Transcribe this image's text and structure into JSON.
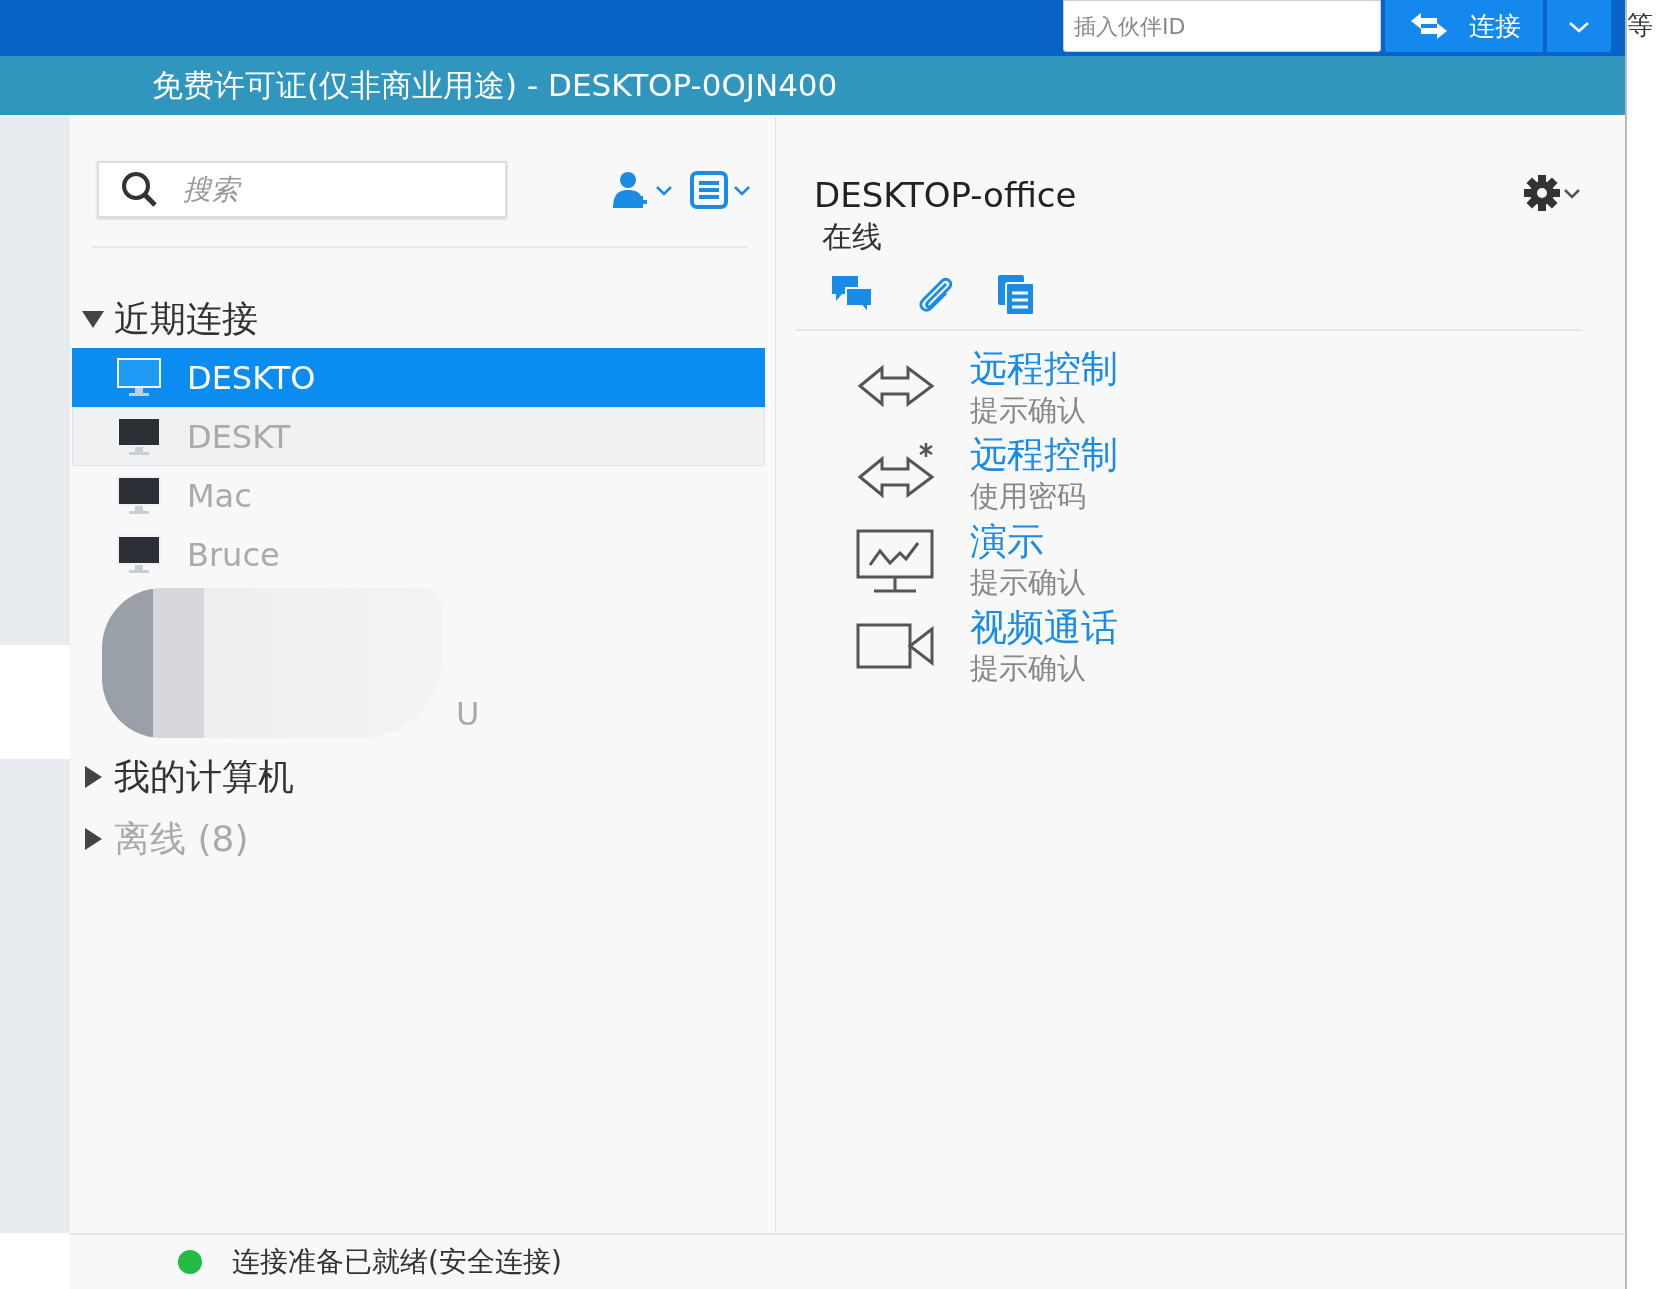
{
  "top_bar": {
    "partner_id_field": {
      "placeholder": "插入伙伴ID"
    },
    "connect_button": "连接",
    "side_text": "等"
  },
  "license_bar": {
    "title": "免费许可证(仅非商业用途) - DESKTOP-0OJN400"
  },
  "search": {
    "placeholder": "搜索"
  },
  "groups": [
    {
      "label": "近期连接",
      "expanded": true,
      "dimmed": false,
      "items": [
        {
          "kind": "computer",
          "name": "DESKTO",
          "selected": true,
          "hovered": false
        },
        {
          "kind": "computer",
          "name": "DESKT",
          "selected": false,
          "hovered": true
        },
        {
          "kind": "computer",
          "name": "Mac",
          "selected": false,
          "hovered": false
        },
        {
          "kind": "computer",
          "name": "Bruce",
          "selected": false,
          "hovered": false
        },
        {
          "kind": "redacted",
          "name": "U"
        }
      ]
    },
    {
      "label": "我的计算机",
      "expanded": false,
      "dimmed": false
    },
    {
      "label": "离线 (8)",
      "expanded": false,
      "dimmed": true
    }
  ],
  "detail": {
    "name": "DESKTOP-office",
    "status": "在线",
    "actions": [
      {
        "kind": "remote",
        "title": "远程控制",
        "subtitle": "提示确认"
      },
      {
        "kind": "remote-password",
        "title": "远程控制",
        "subtitle": "使用密码"
      },
      {
        "kind": "presentation",
        "title": "演示",
        "subtitle": "提示确认"
      },
      {
        "kind": "video",
        "title": "视频通话",
        "subtitle": "提示确认"
      }
    ]
  },
  "status_bar": {
    "text": "连接准备已就绪(安全连接)",
    "ready": true
  }
}
